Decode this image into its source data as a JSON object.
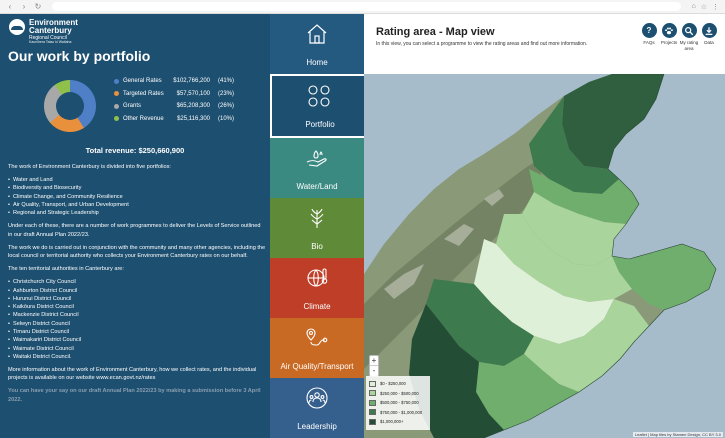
{
  "logo": {
    "line1": "Environment",
    "line2": "Canterbury",
    "line3": "Regional Council",
    "line4": "Kaunihera Taiao ki Waitaha"
  },
  "page_title": "Our work by portfolio",
  "revenue": {
    "items": [
      {
        "name": "General Rates",
        "amount": "$102,766,200",
        "pct": "(41%)",
        "color": "#4f7fc7"
      },
      {
        "name": "Targeted Rates",
        "amount": "$57,570,100",
        "pct": "(23%)",
        "color": "#e8903b"
      },
      {
        "name": "Grants",
        "amount": "$65,208,300",
        "pct": "(26%)",
        "color": "#a8a8a8"
      },
      {
        "name": "Other Revenue",
        "amount": "$25,116,300",
        "pct": "(10%)",
        "color": "#8fc14a"
      }
    ],
    "total": "Total revenue: $250,660,900"
  },
  "body": {
    "intro": "The work of Environment Canterbury is divided into five portfolios:",
    "portfolios": [
      "Water and Land",
      "Biodiversity and Biosecurity",
      "Climate Change, and Community Resilience",
      "Air Quality, Transport, and Urban Development",
      "Regional and Strategic Leadership"
    ],
    "levels": "Under each of these, there are a number of work programmes to deliver the Levels of Service outlined in our draft Annual Plan 2022/23.",
    "partners": "The work we do is carried out in conjunction with the community and many other agencies, including the local council or territorial authority who collects your Environment Canterbury rates on our behalf.",
    "authorities_intro": "The ten territorial authorities in Canterbury are:",
    "authorities": [
      "Christchurch City Council",
      "Ashburton District Council",
      "Hurunui District Council",
      "Kaikōura District Council",
      "Mackenzie District Council",
      "Selwyn District Council",
      "Timaru District Council",
      "Waimakariri District Council",
      "Waimate District Council",
      "Waitaki District Council."
    ],
    "more_info": "More information about the work of Environment Canterbury, how we collect rates, and the individual projects is available on our website www.ecan.govt.nz/rates",
    "cta": "You can have your say on our draft Annual Plan 2022/23 by making a submission before 3 April 2022."
  },
  "nav": [
    {
      "label": "Home",
      "color": "#245980",
      "icon": "house-icon"
    },
    {
      "label": "Portfolio",
      "color": "#1d4f70",
      "icon": "circles-icon"
    },
    {
      "label": "Water/Land",
      "color": "#3a8a82",
      "icon": "water-hand-icon"
    },
    {
      "label": "Bio",
      "color": "#5f8a38",
      "icon": "plant-icon"
    },
    {
      "label": "Climate",
      "color": "#be3e27",
      "icon": "globe-thermometer-icon"
    },
    {
      "label": "Air Quality/Transport",
      "color": "#c96a24",
      "icon": "route-icon"
    },
    {
      "label": "Leadership",
      "color": "#355f8d",
      "icon": "people-icon"
    }
  ],
  "header": {
    "title": "Rating area - Map view",
    "desc": "In this view, you can select a programme to view the rating areas and find out more information.",
    "buttons": [
      {
        "label": "FAQs",
        "icon": "question-icon"
      },
      {
        "label": "Projects",
        "icon": "paw-icon"
      },
      {
        "label": "My rating area",
        "icon": "search-icon"
      },
      {
        "label": "Data",
        "icon": "download-icon"
      }
    ]
  },
  "map": {
    "zoom_in": "+",
    "zoom_out": "-",
    "legend": [
      {
        "label": "$0 - $250,000",
        "color": "#dff0d8"
      },
      {
        "label": "$250,000 - $500,000",
        "color": "#a9d49c"
      },
      {
        "label": "$500,000 - $750,000",
        "color": "#6fae6c"
      },
      {
        "label": "$750,000 - $1,000,000",
        "color": "#3d7a4d"
      },
      {
        "label": "$1,000,000+",
        "color": "#234d35"
      }
    ],
    "attribution": "Leaflet | Map tiles by Stamen Design, CC BY 3.0"
  }
}
